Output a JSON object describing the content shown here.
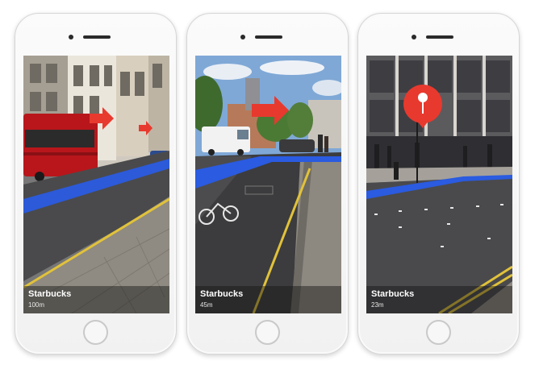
{
  "screens": [
    {
      "place": "Starbucks",
      "distance": "100m",
      "ar_marker": "right-arrow-icon"
    },
    {
      "place": "Starbucks",
      "distance": "45m",
      "ar_marker": "right-arrow-icon"
    },
    {
      "place": "Starbucks",
      "distance": "23m",
      "ar_marker": "map-pin-icon"
    }
  ],
  "colors": {
    "route": "#2a5be0",
    "marker": "#e8392e",
    "phone_body": "#f4f4f4"
  }
}
